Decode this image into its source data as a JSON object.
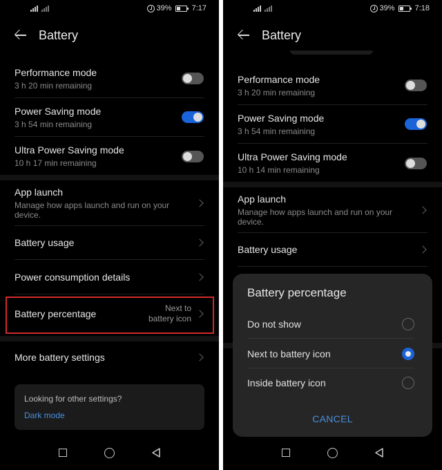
{
  "screens": [
    {
      "status": {
        "battery_percent": "39%",
        "time": "7:17"
      },
      "header": {
        "title": "Battery"
      },
      "modes": [
        {
          "label": "Performance mode",
          "sub": "3 h 20 min remaining",
          "enabled": false
        },
        {
          "label": "Power Saving mode",
          "sub": "3 h 54 min remaining",
          "enabled": true
        },
        {
          "label": "Ultra Power Saving mode",
          "sub": "10 h 17 min remaining",
          "enabled": false
        }
      ],
      "settings": [
        {
          "label": "App launch",
          "sub": "Manage how apps launch and run on your device."
        },
        {
          "label": "Battery usage"
        },
        {
          "label": "Power consumption details"
        },
        {
          "label": "Battery percentage",
          "value_line1": "Next to",
          "value_line2": "battery icon"
        },
        {
          "label": "More battery settings"
        }
      ],
      "tip": {
        "question": "Looking for other settings?",
        "link": "Dark mode"
      },
      "highlight_color": "#d42b2b"
    },
    {
      "status": {
        "battery_percent": "39%",
        "time": "7:18"
      },
      "header": {
        "title": "Battery"
      },
      "modes": [
        {
          "label": "Performance mode",
          "sub": "3 h 20 min remaining",
          "enabled": false
        },
        {
          "label": "Power Saving mode",
          "sub": "3 h 54 min remaining",
          "enabled": true
        },
        {
          "label": "Ultra Power Saving mode",
          "sub": "10 h 14 min remaining",
          "enabled": false
        }
      ],
      "settings": [
        {
          "label": "App launch",
          "sub": "Manage how apps launch and run on your device."
        },
        {
          "label": "Battery usage"
        }
      ],
      "dialog": {
        "title": "Battery percentage",
        "options": [
          {
            "label": "Do not show",
            "selected": false
          },
          {
            "label": "Next to battery icon",
            "selected": true
          },
          {
            "label": "Inside battery icon",
            "selected": false
          }
        ],
        "cancel_label": "CANCEL"
      }
    }
  ],
  "colors": {
    "accent": "#1a63d8",
    "link": "#4a8fe0",
    "background": "#000000",
    "dialog": "#262626"
  },
  "nav_icons": [
    "recents-square-icon",
    "home-circle-icon",
    "back-triangle-icon"
  ]
}
